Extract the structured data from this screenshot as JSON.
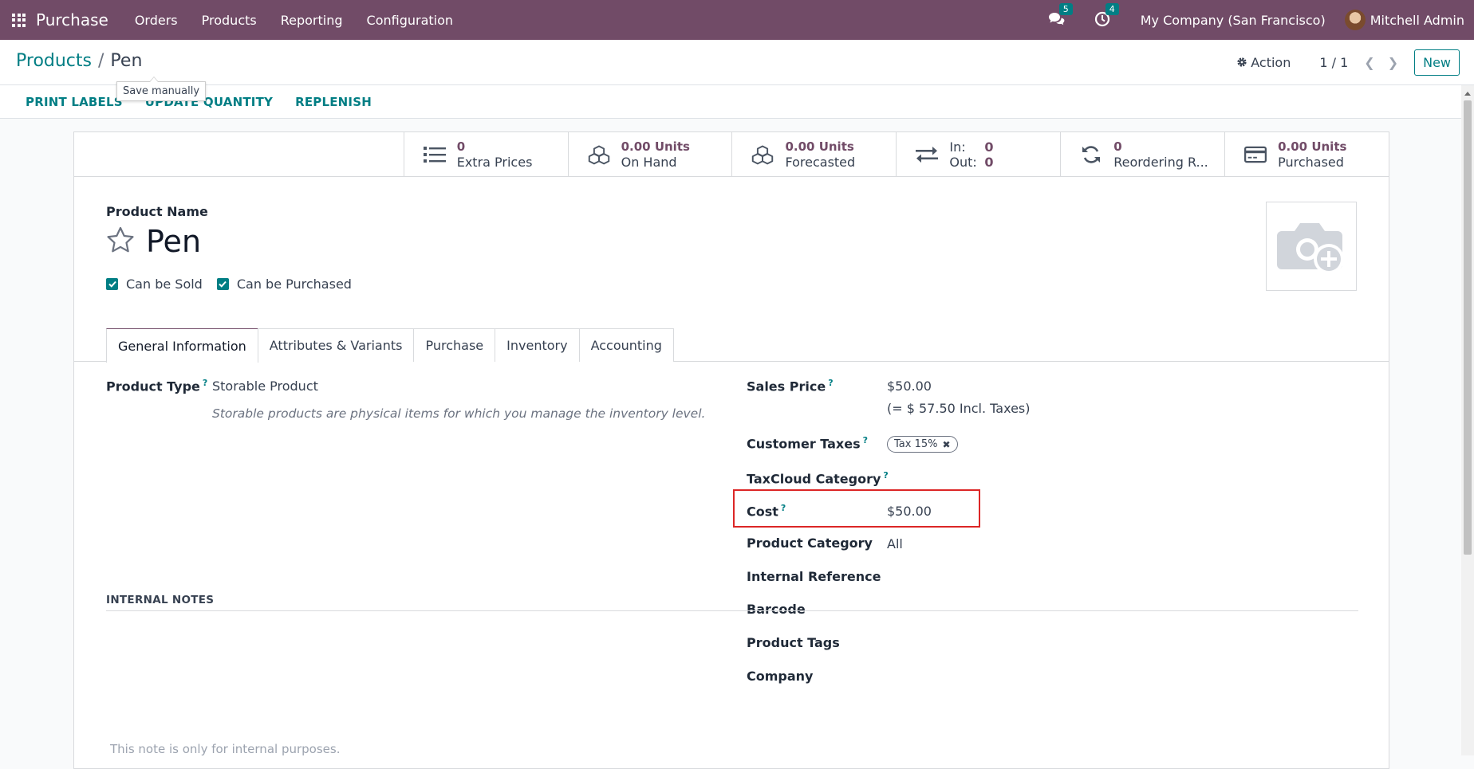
{
  "navbar": {
    "app_name": "Purchase",
    "menu": [
      "Orders",
      "Products",
      "Reporting",
      "Configuration"
    ],
    "messages_count": "5",
    "activities_count": "4",
    "company": "My Company (San Francisco)",
    "user": "Mitchell Admin"
  },
  "breadcrumb": {
    "parent": "Products",
    "current": "Pen"
  },
  "tooltip": "Save manually",
  "control": {
    "action_label": "Action",
    "pager": "1 / 1",
    "new_label": "New"
  },
  "header_buttons": [
    "PRINT LABELS",
    "UPDATE QUANTITY",
    "REPLENISH"
  ],
  "smart_buttons": {
    "extra_prices": {
      "value": "0",
      "label": "Extra Prices"
    },
    "on_hand": {
      "value": "0.00 Units",
      "label": "On Hand"
    },
    "forecasted": {
      "value": "0.00 Units",
      "label": "Forecasted"
    },
    "in_out": {
      "in_label": "In:",
      "in_value": "0",
      "out_label": "Out:",
      "out_value": "0"
    },
    "reordering": {
      "value": "0",
      "label": "Reordering R..."
    },
    "purchased": {
      "value": "0.00 Units",
      "label": "Purchased"
    }
  },
  "product": {
    "name_label": "Product Name",
    "name": "Pen",
    "can_be_sold": "Can be Sold",
    "can_be_purchased": "Can be Purchased"
  },
  "tabs": [
    "General Information",
    "Attributes & Variants",
    "Purchase",
    "Inventory",
    "Accounting"
  ],
  "general": {
    "product_type_label": "Product Type",
    "product_type": "Storable Product",
    "product_type_help": "Storable products are physical items for which you manage the inventory level.",
    "sales_price_label": "Sales Price",
    "sales_price": "$50.00",
    "incl_taxes": "(= $ 57.50 Incl. Taxes)",
    "customer_taxes_label": "Customer Taxes",
    "customer_tax_tag": "Tax 15%",
    "taxcloud_label": "TaxCloud Category",
    "cost_label": "Cost",
    "cost": "$50.00",
    "category_label": "Product Category",
    "category": "All",
    "internal_ref_label": "Internal Reference",
    "barcode_label": "Barcode",
    "tags_label": "Product Tags",
    "company_label": "Company"
  },
  "notes": {
    "title": "INTERNAL NOTES",
    "placeholder": "This note is only for internal purposes."
  },
  "colors": {
    "brand": "#714b67",
    "accent": "#017e84",
    "highlight": "#dc2626"
  }
}
